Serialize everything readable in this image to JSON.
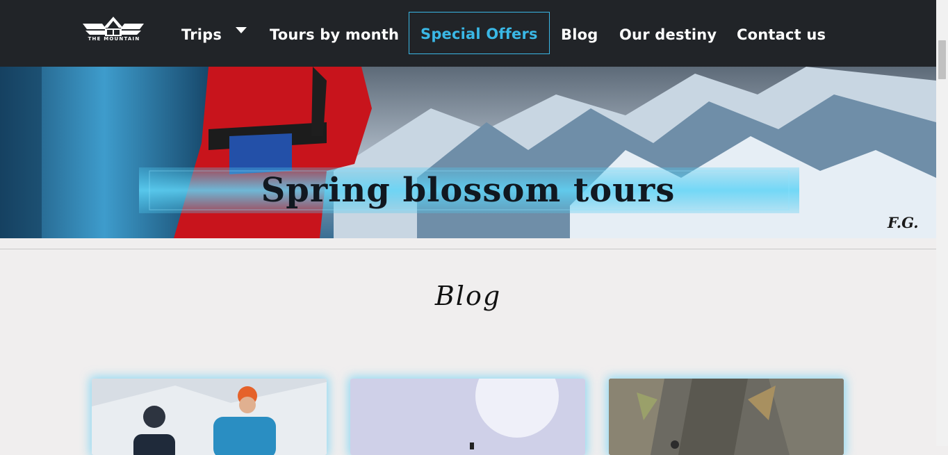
{
  "brand": {
    "logo_text": "THE MOUNTAIN"
  },
  "nav": {
    "items": [
      {
        "label": "Trips"
      },
      {
        "label": "Tours by month"
      },
      {
        "label": "Special Offers"
      },
      {
        "label": "Blog"
      },
      {
        "label": "Our destiny"
      },
      {
        "label": "Contact us"
      }
    ]
  },
  "hero": {
    "title": "Spring blossom tours",
    "signature": "F.G."
  },
  "section": {
    "title": "Blog"
  },
  "colors": {
    "navbar": "#212428",
    "accent": "#3ab8e6",
    "page_bg": "#f0eeee"
  },
  "icons": [
    "mountain-logo-icon",
    "caret-down-icon"
  ]
}
